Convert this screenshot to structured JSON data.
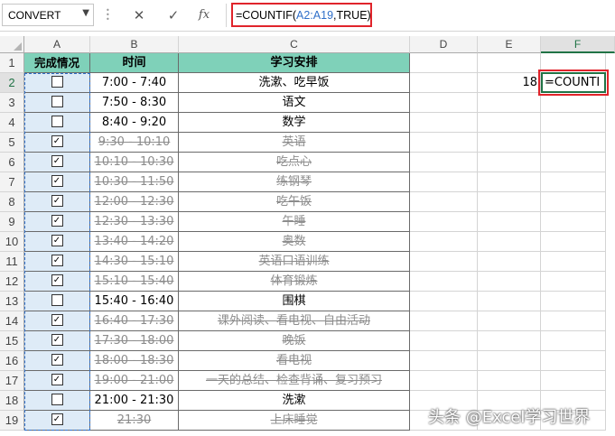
{
  "formula_bar": {
    "name_box": "CONVERT",
    "cancel_icon": "✕",
    "enter_icon": "✓",
    "fx_label": "fx",
    "formula_prefix": "=COUNTIF(",
    "formula_ref": "A2:A19",
    "formula_suffix": ",TRUE)"
  },
  "columns": [
    "A",
    "B",
    "C",
    "D",
    "E",
    "F"
  ],
  "header_row": {
    "a": "完成情况",
    "b": "时间",
    "c": "学习安排"
  },
  "rows": [
    {
      "num": "2",
      "checked": false,
      "time": "7:00 - 7:40",
      "task": "洗漱、吃早饭"
    },
    {
      "num": "3",
      "checked": false,
      "time": "7:50 - 8:30",
      "task": "语文"
    },
    {
      "num": "4",
      "checked": false,
      "time": "8:40 - 9:20",
      "task": "数学"
    },
    {
      "num": "5",
      "checked": true,
      "time": "9:30 - 10:10",
      "task": "英语"
    },
    {
      "num": "6",
      "checked": true,
      "time": "10:10 - 10:30",
      "task": "吃点心"
    },
    {
      "num": "7",
      "checked": true,
      "time": "10:30 - 11:50",
      "task": "练钢琴"
    },
    {
      "num": "8",
      "checked": true,
      "time": "12:00 - 12:30",
      "task": "吃午饭"
    },
    {
      "num": "9",
      "checked": true,
      "time": "12:30 - 13:30",
      "task": "午睡"
    },
    {
      "num": "10",
      "checked": true,
      "time": "13:40 - 14:20",
      "task": "奥数"
    },
    {
      "num": "11",
      "checked": true,
      "time": "14:30 - 15:10",
      "task": "英语口语训练"
    },
    {
      "num": "12",
      "checked": true,
      "time": "15:10 - 15:40",
      "task": "体育锻炼"
    },
    {
      "num": "13",
      "checked": false,
      "time": "15:40 - 16:40",
      "task": "围棋"
    },
    {
      "num": "14",
      "checked": true,
      "time": "16:40 - 17:30",
      "task": "课外阅读、看电视、自由活动"
    },
    {
      "num": "15",
      "checked": true,
      "time": "17:30 - 18:00",
      "task": "晚饭"
    },
    {
      "num": "16",
      "checked": true,
      "time": "18:00 - 18:30",
      "task": "看电视"
    },
    {
      "num": "17",
      "checked": true,
      "time": "19:00 - 21:00",
      "task": "一天的总结、检查背诵、复习预习"
    },
    {
      "num": "18",
      "checked": false,
      "time": "21:00 - 21:30",
      "task": "洗漱"
    },
    {
      "num": "19",
      "checked": true,
      "time": "21:30",
      "task": "上床睡觉"
    }
  ],
  "row1_num": "1",
  "e2_value": "18",
  "f2_editing": "=COUNTI",
  "watermark": "头条 @Excel学习世界",
  "colors": {
    "header_fill": "#7fd1b9",
    "column_a_fill": "#deebf7",
    "done_text": "#8c8c8c",
    "highlight_border": "#e0242b",
    "active_border": "#217346",
    "range_ref": "#2f6fc9"
  }
}
